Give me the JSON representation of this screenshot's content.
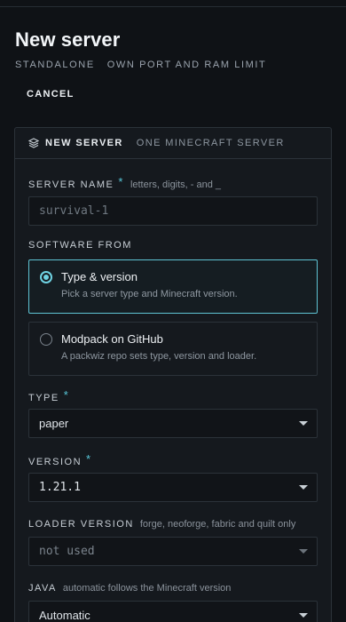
{
  "header": {
    "title": "New server",
    "subtitle_left": "STANDALONE",
    "subtitle_right": "OWN PORT AND RAM LIMIT",
    "cancel_label": "CANCEL"
  },
  "card": {
    "icon": "layers-icon",
    "title": "NEW SERVER",
    "subtitle": "ONE MINECRAFT SERVER"
  },
  "form": {
    "server_name": {
      "label": "SERVER NAME",
      "required": "*",
      "hint": "letters, digits, - and _",
      "placeholder": "survival-1"
    },
    "software_from": {
      "label": "SOFTWARE FROM",
      "options": [
        {
          "title": "Type & version",
          "description": "Pick a server type and Minecraft version.",
          "selected": true
        },
        {
          "title": "Modpack on GitHub",
          "description": "A packwiz repo sets type, version and loader.",
          "selected": false
        }
      ]
    },
    "type": {
      "label": "TYPE",
      "required": "*",
      "value": "paper"
    },
    "version": {
      "label": "VERSION",
      "required": "*",
      "value": "1.21.1"
    },
    "loader_version": {
      "label": "LOADER VERSION",
      "hint": "forge, neoforge, fabric and quilt only",
      "value": "not used"
    },
    "java": {
      "label": "JAVA",
      "hint": "automatic follows the Minecraft version",
      "value": "Automatic"
    }
  },
  "colors": {
    "accent": "#6fd3e3",
    "background": "#0f1216",
    "card": "#15191e",
    "border": "#2b3239"
  }
}
